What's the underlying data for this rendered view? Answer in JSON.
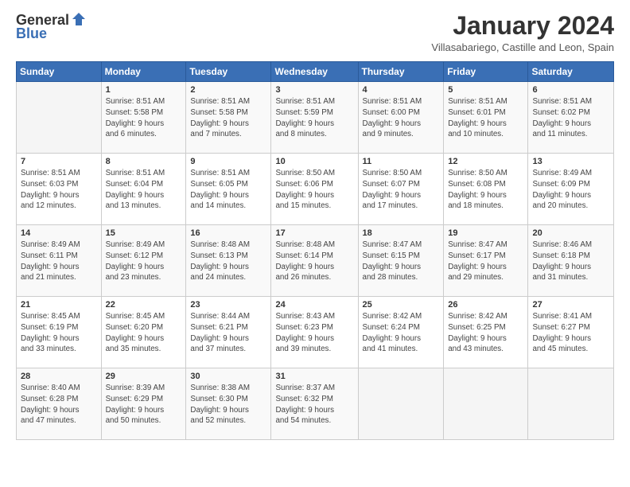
{
  "header": {
    "logo_line1": "General",
    "logo_line2": "Blue",
    "month_title": "January 2024",
    "subtitle": "Villasabariego, Castille and Leon, Spain"
  },
  "weekdays": [
    "Sunday",
    "Monday",
    "Tuesday",
    "Wednesday",
    "Thursday",
    "Friday",
    "Saturday"
  ],
  "weeks": [
    [
      {
        "day": "",
        "info": ""
      },
      {
        "day": "1",
        "info": "Sunrise: 8:51 AM\nSunset: 5:58 PM\nDaylight: 9 hours\nand 6 minutes."
      },
      {
        "day": "2",
        "info": "Sunrise: 8:51 AM\nSunset: 5:58 PM\nDaylight: 9 hours\nand 7 minutes."
      },
      {
        "day": "3",
        "info": "Sunrise: 8:51 AM\nSunset: 5:59 PM\nDaylight: 9 hours\nand 8 minutes."
      },
      {
        "day": "4",
        "info": "Sunrise: 8:51 AM\nSunset: 6:00 PM\nDaylight: 9 hours\nand 9 minutes."
      },
      {
        "day": "5",
        "info": "Sunrise: 8:51 AM\nSunset: 6:01 PM\nDaylight: 9 hours\nand 10 minutes."
      },
      {
        "day": "6",
        "info": "Sunrise: 8:51 AM\nSunset: 6:02 PM\nDaylight: 9 hours\nand 11 minutes."
      }
    ],
    [
      {
        "day": "7",
        "info": "Sunrise: 8:51 AM\nSunset: 6:03 PM\nDaylight: 9 hours\nand 12 minutes."
      },
      {
        "day": "8",
        "info": "Sunrise: 8:51 AM\nSunset: 6:04 PM\nDaylight: 9 hours\nand 13 minutes."
      },
      {
        "day": "9",
        "info": "Sunrise: 8:51 AM\nSunset: 6:05 PM\nDaylight: 9 hours\nand 14 minutes."
      },
      {
        "day": "10",
        "info": "Sunrise: 8:50 AM\nSunset: 6:06 PM\nDaylight: 9 hours\nand 15 minutes."
      },
      {
        "day": "11",
        "info": "Sunrise: 8:50 AM\nSunset: 6:07 PM\nDaylight: 9 hours\nand 17 minutes."
      },
      {
        "day": "12",
        "info": "Sunrise: 8:50 AM\nSunset: 6:08 PM\nDaylight: 9 hours\nand 18 minutes."
      },
      {
        "day": "13",
        "info": "Sunrise: 8:49 AM\nSunset: 6:09 PM\nDaylight: 9 hours\nand 20 minutes."
      }
    ],
    [
      {
        "day": "14",
        "info": "Sunrise: 8:49 AM\nSunset: 6:11 PM\nDaylight: 9 hours\nand 21 minutes."
      },
      {
        "day": "15",
        "info": "Sunrise: 8:49 AM\nSunset: 6:12 PM\nDaylight: 9 hours\nand 23 minutes."
      },
      {
        "day": "16",
        "info": "Sunrise: 8:48 AM\nSunset: 6:13 PM\nDaylight: 9 hours\nand 24 minutes."
      },
      {
        "day": "17",
        "info": "Sunrise: 8:48 AM\nSunset: 6:14 PM\nDaylight: 9 hours\nand 26 minutes."
      },
      {
        "day": "18",
        "info": "Sunrise: 8:47 AM\nSunset: 6:15 PM\nDaylight: 9 hours\nand 28 minutes."
      },
      {
        "day": "19",
        "info": "Sunrise: 8:47 AM\nSunset: 6:17 PM\nDaylight: 9 hours\nand 29 minutes."
      },
      {
        "day": "20",
        "info": "Sunrise: 8:46 AM\nSunset: 6:18 PM\nDaylight: 9 hours\nand 31 minutes."
      }
    ],
    [
      {
        "day": "21",
        "info": "Sunrise: 8:45 AM\nSunset: 6:19 PM\nDaylight: 9 hours\nand 33 minutes."
      },
      {
        "day": "22",
        "info": "Sunrise: 8:45 AM\nSunset: 6:20 PM\nDaylight: 9 hours\nand 35 minutes."
      },
      {
        "day": "23",
        "info": "Sunrise: 8:44 AM\nSunset: 6:21 PM\nDaylight: 9 hours\nand 37 minutes."
      },
      {
        "day": "24",
        "info": "Sunrise: 8:43 AM\nSunset: 6:23 PM\nDaylight: 9 hours\nand 39 minutes."
      },
      {
        "day": "25",
        "info": "Sunrise: 8:42 AM\nSunset: 6:24 PM\nDaylight: 9 hours\nand 41 minutes."
      },
      {
        "day": "26",
        "info": "Sunrise: 8:42 AM\nSunset: 6:25 PM\nDaylight: 9 hours\nand 43 minutes."
      },
      {
        "day": "27",
        "info": "Sunrise: 8:41 AM\nSunset: 6:27 PM\nDaylight: 9 hours\nand 45 minutes."
      }
    ],
    [
      {
        "day": "28",
        "info": "Sunrise: 8:40 AM\nSunset: 6:28 PM\nDaylight: 9 hours\nand 47 minutes."
      },
      {
        "day": "29",
        "info": "Sunrise: 8:39 AM\nSunset: 6:29 PM\nDaylight: 9 hours\nand 50 minutes."
      },
      {
        "day": "30",
        "info": "Sunrise: 8:38 AM\nSunset: 6:30 PM\nDaylight: 9 hours\nand 52 minutes."
      },
      {
        "day": "31",
        "info": "Sunrise: 8:37 AM\nSunset: 6:32 PM\nDaylight: 9 hours\nand 54 minutes."
      },
      {
        "day": "",
        "info": ""
      },
      {
        "day": "",
        "info": ""
      },
      {
        "day": "",
        "info": ""
      }
    ]
  ]
}
